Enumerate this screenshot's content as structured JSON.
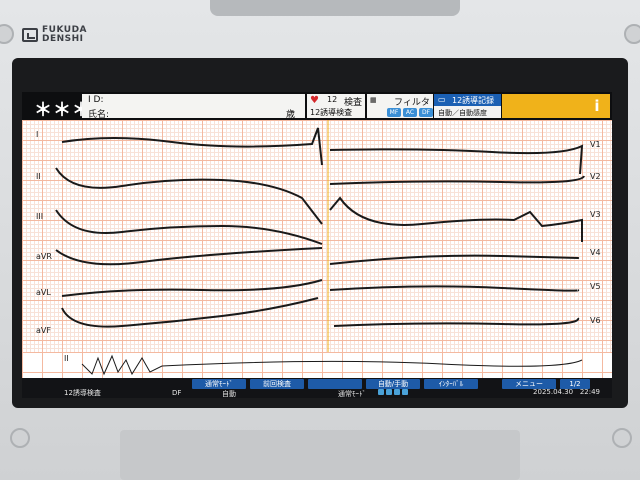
{
  "device": {
    "brand_line1": "FUKUDA",
    "brand_line2": "DENSHI"
  },
  "header": {
    "patient_mask": "＊＊＊",
    "id_label": "I D:",
    "name_label": "氏名:",
    "age_unit": "歳",
    "mode_number": "12",
    "exam_label": "検査",
    "mode_label": "12誘導検査",
    "filter_label": "フィルタ",
    "filter_chips": [
      "MF",
      "AC",
      "DF"
    ],
    "record_label": "12誘導記録",
    "record_sub": "自動／自動感度",
    "info_icon": "info-icon"
  },
  "leads_left": [
    "I",
    "II",
    "III",
    "aVR",
    "aVL",
    "aVF"
  ],
  "leads_right": [
    "V1",
    "V2",
    "V3",
    "V4",
    "V5",
    "V6"
  ],
  "rhythm_lead": "II",
  "footer": {
    "mode_status": "12誘導検査",
    "df_status": "DF",
    "auto_status": "自動",
    "buttons": [
      "通常ﾓｰﾄﾞ",
      "前回検査",
      "",
      "自動/手動",
      "ｲﾝﾀｰﾊﾞﾙ",
      "メニュー",
      "1/2"
    ],
    "mode_sub": "通常ﾓｰﾄﾞ",
    "date": "2025.04.30",
    "time": "22:49"
  },
  "colors": {
    "topbar": "#0d0e10",
    "info": "#f0b21a",
    "record": "#1a5fb3",
    "grid": "#f4b9a0"
  }
}
